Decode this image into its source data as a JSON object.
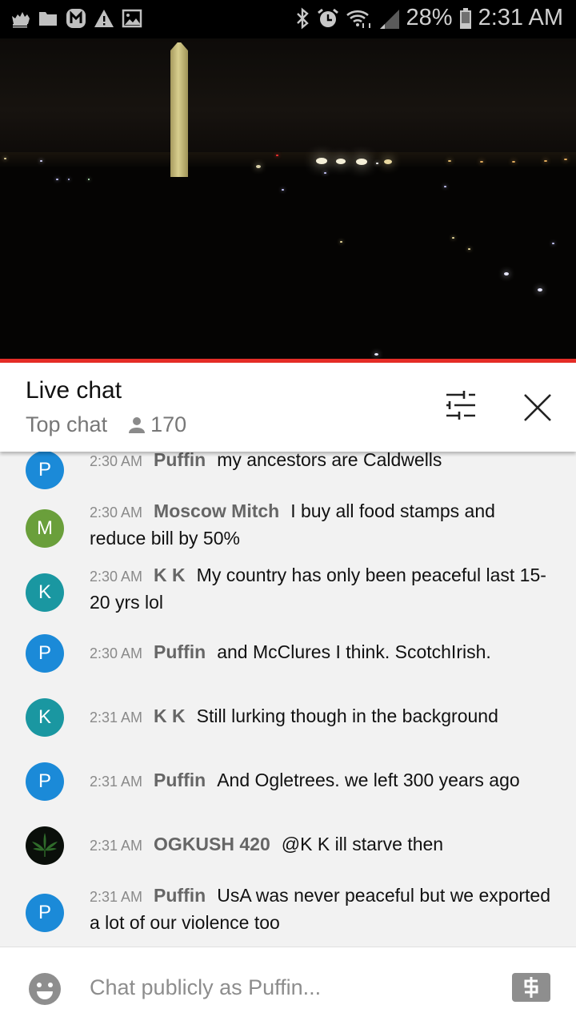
{
  "status_bar": {
    "left_icons": [
      "crown-icon",
      "folder-icon",
      "m-app-icon",
      "warning-icon",
      "image-icon"
    ],
    "right_icons": [
      "bluetooth-icon",
      "alarm-icon",
      "wifi-icon",
      "signal-icon"
    ],
    "battery": "28%",
    "battery_level": 0.28,
    "time": "2:31 AM"
  },
  "video": {
    "progress_color": "#e52d27"
  },
  "chat_header": {
    "title": "Live chat",
    "mode": "Top chat",
    "viewer_count": "170"
  },
  "messages": [
    {
      "initial": "P",
      "avatar_color": "#1b8ad8",
      "time": "2:30 AM",
      "author": "Puffin",
      "text": "my ancestors are Caldwells"
    },
    {
      "initial": "M",
      "avatar_color": "#6a9f3b",
      "time": "2:30 AM",
      "author": "Moscow Mitch",
      "text": "I buy all food stamps and reduce bill by 50%"
    },
    {
      "initial": "K",
      "avatar_color": "#1a97a1",
      "time": "2:30 AM",
      "author": "K K",
      "text": "My country has only been peaceful last 15-20 yrs lol"
    },
    {
      "initial": "P",
      "avatar_color": "#1b8ad8",
      "time": "2:30 AM",
      "author": "Puffin",
      "text": "and McClures I think. ScotchIrish."
    },
    {
      "initial": "K",
      "avatar_color": "#1a97a1",
      "time": "2:31 AM",
      "author": "K K",
      "text": "Still lurking though in the background"
    },
    {
      "initial": "P",
      "avatar_color": "#1b8ad8",
      "time": "2:31 AM",
      "author": "Puffin",
      "text": "And Ogletrees. we left 300 years ago"
    },
    {
      "initial": "",
      "avatar_color": "#0a0f0a",
      "avatar_icon": "cannabis-leaf-icon",
      "time": "2:31 AM",
      "author": "OGKUSH 420",
      "text": "@K K ill starve then"
    },
    {
      "initial": "P",
      "avatar_color": "#1b8ad8",
      "time": "2:31 AM",
      "author": "Puffin",
      "text": "UsA was never peaceful but we exported a lot of our violence too"
    }
  ],
  "chat_input": {
    "placeholder": "Chat publicly as Puffin...",
    "value": ""
  }
}
